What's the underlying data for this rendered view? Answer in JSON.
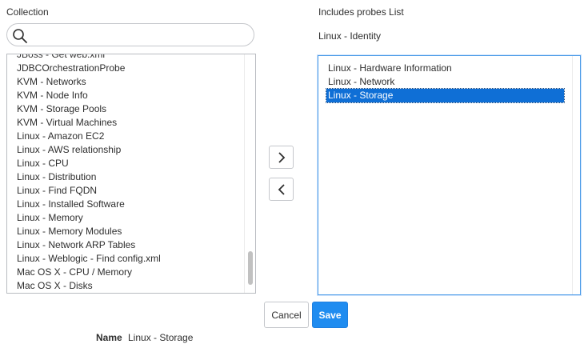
{
  "collection": {
    "label": "Collection",
    "search": {
      "value": "",
      "placeholder": "",
      "icon": "search-icon"
    },
    "items": [
      "JBoss - Get web.xml",
      "JDBCOrchestrationProbe",
      "KVM - Networks",
      "KVM - Node Info",
      "KVM - Storage Pools",
      "KVM - Virtual Machines",
      "Linux - Amazon EC2",
      "Linux - AWS relationship",
      "Linux - CPU",
      "Linux - Distribution",
      "Linux - Find FQDN",
      "Linux - Installed Software",
      "Linux - Memory",
      "Linux - Memory Modules",
      "Linux - Network ARP Tables",
      "Linux - Weblogic - Find config.xml",
      "Mac OS X - CPU / Memory",
      "Mac OS X - Disks"
    ]
  },
  "includes": {
    "label": "Includes probes List",
    "parent": "Linux - Identity",
    "items": [
      {
        "label": "Linux - Hardware Information",
        "selected": false
      },
      {
        "label": "Linux - Network",
        "selected": false
      },
      {
        "label": "Linux - Storage",
        "selected": true
      }
    ]
  },
  "move": {
    "add_icon": "chevron-right-icon",
    "remove_icon": "chevron-left-icon"
  },
  "actions": {
    "cancel": "Cancel",
    "save": "Save"
  },
  "footer": {
    "name_label": "Name",
    "name_value": "Linux - Storage"
  },
  "colors": {
    "accent": "#1f8cf0",
    "selection": "#0f6fd6",
    "border": "#c5c7cb"
  }
}
